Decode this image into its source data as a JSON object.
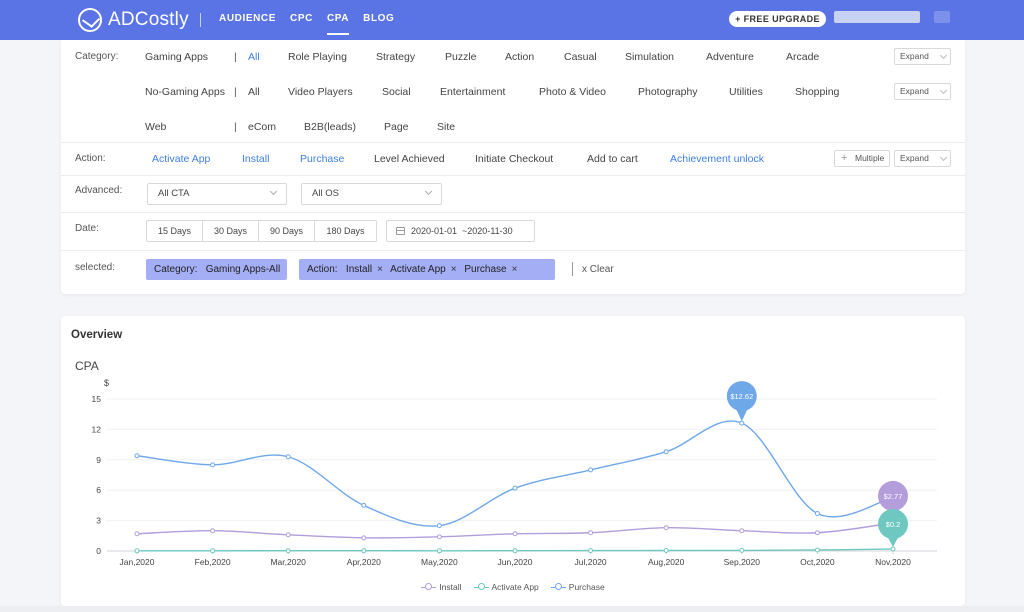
{
  "brand": {
    "name": "ADCostly"
  },
  "nav": [
    {
      "label": "AUDIENCE",
      "active": false
    },
    {
      "label": "CPC",
      "active": false
    },
    {
      "label": "CPA",
      "active": true
    },
    {
      "label": "BLOG",
      "active": false
    }
  ],
  "upgrade_label": "+ FREE UPGRADE",
  "filters": {
    "category_label": "Category:",
    "rows": [
      {
        "group": "Gaming Apps",
        "items": [
          "All",
          "Role Playing",
          "Strategy",
          "Puzzle",
          "Action",
          "Casual",
          "Simulation",
          "Adventure",
          "Arcade"
        ],
        "selected": "All",
        "expand": "Expand"
      },
      {
        "group": "No-Gaming Apps",
        "items": [
          "All",
          "Video Players",
          "Social",
          "Entertainment",
          "Photo & Video",
          "Photography",
          "Utilities",
          "Shopping"
        ],
        "expand": "Expand"
      },
      {
        "group": "Web",
        "items": [
          "eCom",
          "B2B(leads)",
          "Page",
          "Site"
        ]
      }
    ],
    "action_label": "Action:",
    "actions": [
      {
        "label": "Activate App",
        "selected": true
      },
      {
        "label": "Install",
        "selected": true
      },
      {
        "label": "Purchase",
        "selected": true
      },
      {
        "label": "Level Achieved",
        "selected": false
      },
      {
        "label": "Initiate Checkout",
        "selected": false
      },
      {
        "label": "Add to cart",
        "selected": false
      },
      {
        "label": "Achievement unlock",
        "selected": true
      }
    ],
    "multiple_label": "Multiple",
    "action_expand": "Expand",
    "advanced_label": "Advanced:",
    "cta_select": "All CTA",
    "os_select": "All OS",
    "date_label": "Date:",
    "day_options": [
      "15 Days",
      "30 Days",
      "90 Days",
      "180 Days"
    ],
    "date_range": "2020-01-01  ~2020-11-30",
    "selected_label": "selected:",
    "category_tag": "Category:   Gaming Apps-All",
    "action_tag_prefix": "Action:",
    "action_tag_items": [
      "Install",
      "Activate App",
      "Purchase"
    ],
    "clear_label": "x Clear"
  },
  "overview": {
    "title": "Overview"
  },
  "chart_data": {
    "type": "line",
    "title": "CPA",
    "ylabel": "$",
    "xlabel": "",
    "ylim": [
      0,
      15
    ],
    "yticks": [
      0,
      3,
      6,
      9,
      12,
      15
    ],
    "categories": [
      "Jan,2020",
      "Feb,2020",
      "Mar,2020",
      "Apr,2020",
      "May,2020",
      "Jun,2020",
      "Jul,2020",
      "Aug,2020",
      "Sep,2020",
      "Oct,2020",
      "Nov,2020"
    ],
    "grid": true,
    "legend_position": "bottom",
    "series": [
      {
        "name": "Install",
        "color": "#b39ddb",
        "values": [
          1.7,
          2.0,
          1.6,
          1.3,
          1.4,
          1.7,
          1.8,
          2.3,
          2.0,
          1.8,
          2.77
        ]
      },
      {
        "name": "Activate App",
        "color": "#6ec8c0",
        "values": [
          0.02,
          0.02,
          0.03,
          0.03,
          0.02,
          0.03,
          0.04,
          0.05,
          0.06,
          0.1,
          0.2
        ]
      },
      {
        "name": "Purchase",
        "color": "#6fa8e8",
        "values": [
          9.4,
          8.5,
          9.3,
          4.5,
          2.5,
          6.2,
          8.0,
          9.8,
          12.62,
          3.7,
          5.3
        ]
      }
    ],
    "annotations": [
      {
        "series": "Purchase",
        "label": "$12.62",
        "index": 8
      },
      {
        "series": "Install",
        "label": "$2.77",
        "index": 10
      },
      {
        "series": "Activate App",
        "label": "$0.2",
        "index": 10
      }
    ]
  }
}
